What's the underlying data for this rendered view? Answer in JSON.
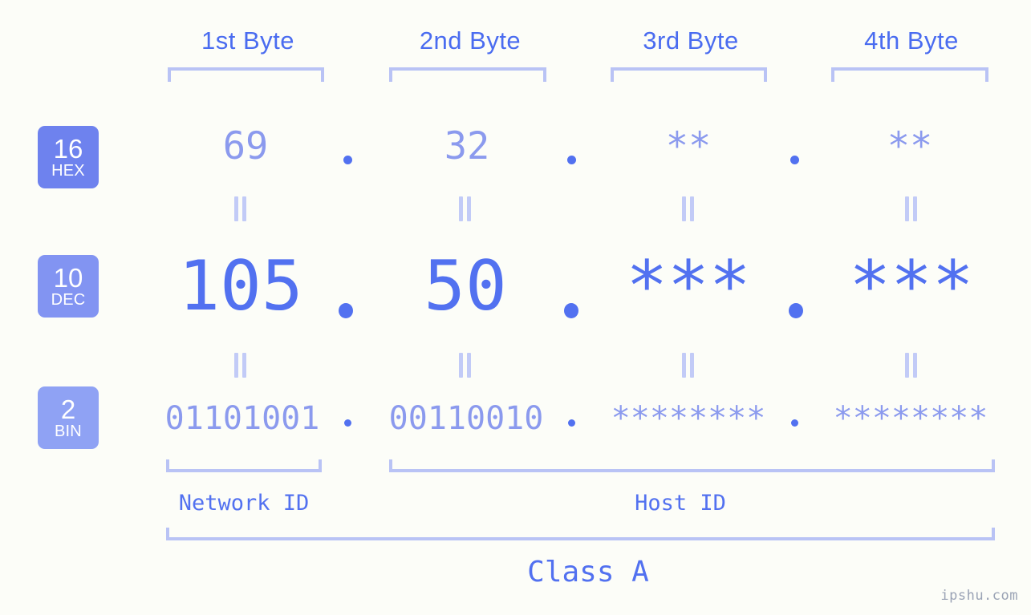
{
  "watermark": "ipshu.com",
  "byte_headers": [
    {
      "label": "1st Byte"
    },
    {
      "label": "2nd Byte"
    },
    {
      "label": "3rd Byte"
    },
    {
      "label": "4th Byte"
    }
  ],
  "bases": [
    {
      "number": "16",
      "name": "HEX",
      "color": "#6e82ee"
    },
    {
      "number": "10",
      "name": "DEC",
      "color": "#8294f2"
    },
    {
      "number": "2",
      "name": "BIN",
      "color": "#8fa2f4"
    }
  ],
  "rows": {
    "hex": {
      "base_number": "16",
      "base_name": "HEX",
      "values": [
        "69",
        "32",
        "**",
        "**"
      ]
    },
    "dec": {
      "base_number": "10",
      "base_name": "DEC",
      "values": [
        "105",
        "50",
        "***",
        "***"
      ]
    },
    "bin": {
      "base_number": "2",
      "base_name": "BIN",
      "values": [
        "01101001",
        "00110010",
        "********",
        "********"
      ]
    }
  },
  "separators": {
    "dot": ".",
    "equals": "="
  },
  "segments": {
    "network_id": "Network ID",
    "host_id": "Host ID",
    "class": "Class A"
  },
  "colors": {
    "background": "#fcfdf8",
    "accent_strong": "#5271f0",
    "accent_light": "#8b9aee",
    "bracket": "#b9c3f5",
    "equals": "#c2cbf7",
    "badge_hex": "#6e82ee",
    "badge_dec": "#8294f2",
    "badge_bin": "#8fa2f4",
    "watermark": "#9aa3b5"
  },
  "chart_data": {
    "type": "table",
    "title": "IP address 105.50.*.* byte decomposition",
    "columns": [
      "1st Byte",
      "2nd Byte",
      "3rd Byte",
      "4th Byte"
    ],
    "rows": [
      {
        "base": 16,
        "base_name": "HEX",
        "values": [
          "69",
          "32",
          "**",
          "**"
        ]
      },
      {
        "base": 10,
        "base_name": "DEC",
        "values": [
          "105",
          "50",
          "***",
          "***"
        ]
      },
      {
        "base": 2,
        "base_name": "BIN",
        "values": [
          "01101001",
          "00110010",
          "********",
          "********"
        ]
      }
    ],
    "annotations": {
      "network_id_bytes": [
        1
      ],
      "host_id_bytes": [
        2,
        3,
        4
      ],
      "class": "Class A"
    }
  }
}
